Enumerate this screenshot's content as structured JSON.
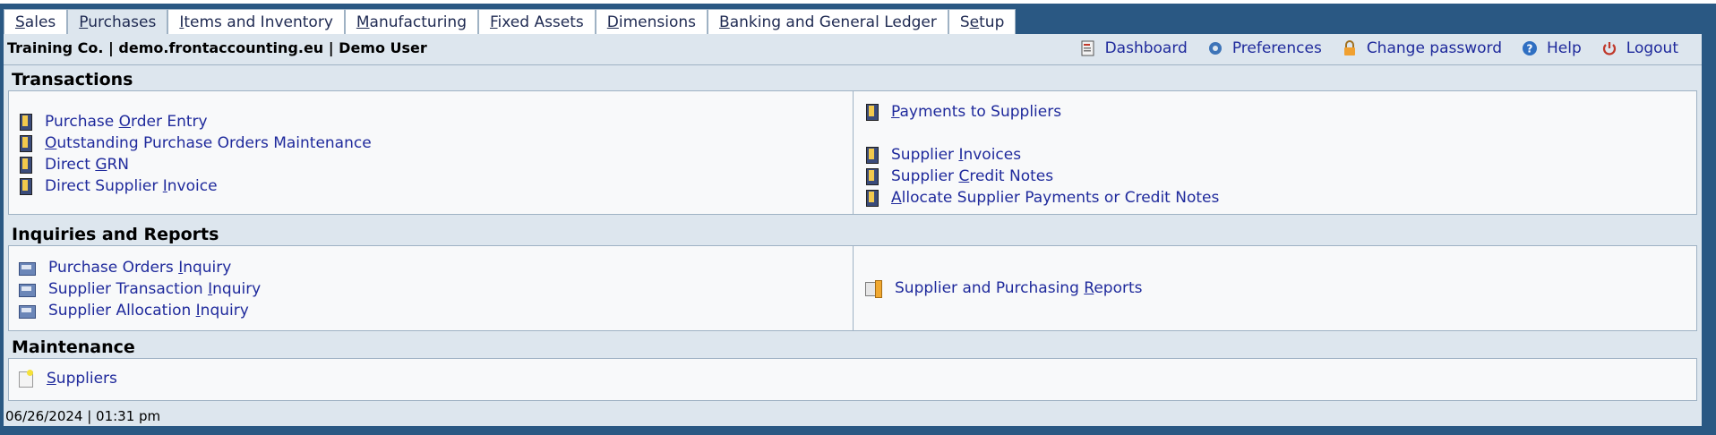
{
  "tabs": [
    {
      "pre": "",
      "u": "S",
      "post": "ales"
    },
    {
      "pre": "",
      "u": "P",
      "post": "urchases"
    },
    {
      "pre": "",
      "u": "I",
      "post": "tems and Inventory"
    },
    {
      "pre": "",
      "u": "M",
      "post": "anufacturing"
    },
    {
      "pre": "",
      "u": "F",
      "post": "ixed Assets"
    },
    {
      "pre": "",
      "u": "D",
      "post": "imensions"
    },
    {
      "pre": "",
      "u": "B",
      "post": "anking and General Ledger"
    },
    {
      "pre": "S",
      "u": "e",
      "post": "tup"
    }
  ],
  "header": {
    "company": "Training Co. | demo.frontaccounting.eu | Demo User",
    "links": {
      "dashboard": "Dashboard",
      "preferences": "Preferences",
      "change_password": "Change password",
      "help": "Help",
      "logout": "Logout"
    }
  },
  "sections": {
    "transactions": "Transactions",
    "inquiries": "Inquiries and Reports",
    "maintenance": "Maintenance"
  },
  "transactions_left": [
    {
      "pre": "Purchase ",
      "u": "O",
      "post": "rder Entry"
    },
    {
      "pre": "",
      "u": "O",
      "post": "utstanding Purchase Orders Maintenance"
    },
    {
      "pre": "Direct ",
      "u": "G",
      "post": "RN"
    },
    {
      "pre": "Direct Supplier ",
      "u": "I",
      "post": "nvoice"
    }
  ],
  "transactions_right": [
    {
      "pre": "",
      "u": "P",
      "post": "ayments to Suppliers"
    },
    {
      "pre": "Supplier ",
      "u": "I",
      "post": "nvoices"
    },
    {
      "pre": "Supplier ",
      "u": "C",
      "post": "redit Notes"
    },
    {
      "pre": "",
      "u": "A",
      "post": "llocate Supplier Payments or Credit Notes"
    }
  ],
  "inquiries_left": [
    {
      "pre": "Purchase Orders ",
      "u": "I",
      "post": "nquiry"
    },
    {
      "pre": "Supplier Transaction ",
      "u": "I",
      "post": "nquiry"
    },
    {
      "pre": "Supplier Allocation ",
      "u": "I",
      "post": "nquiry"
    }
  ],
  "inquiries_right": [
    {
      "pre": "Supplier and Purchasing ",
      "u": "R",
      "post": "eports"
    }
  ],
  "maintenance_items": [
    {
      "pre": "",
      "u": "S",
      "post": "uppliers"
    }
  ],
  "footer": "06/26/2024 | 01:31 pm",
  "colors": {
    "frame": "#2a5883",
    "panel": "#dde6ee",
    "link": "#1f2a9c"
  }
}
